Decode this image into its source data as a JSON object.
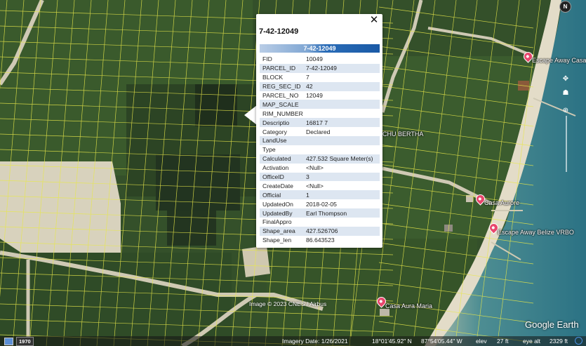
{
  "popup": {
    "title": "7-42-12049",
    "close_glyph": "✕",
    "header": "7-42-12049",
    "attributes": [
      {
        "key": "FID",
        "value": "10049"
      },
      {
        "key": "PARCEL_ID",
        "value": "7-42-12049"
      },
      {
        "key": "BLOCK",
        "value": "7"
      },
      {
        "key": "REG_SEC_ID",
        "value": "42"
      },
      {
        "key": "PARCEL_NO",
        "value": "12049"
      },
      {
        "key": "MAP_SCALE",
        "value": ""
      },
      {
        "key": "RIM_NUMBER",
        "value": ""
      },
      {
        "key": "Descriptio",
        "value": "16817 7"
      },
      {
        "key": "Category",
        "value": "Declared"
      },
      {
        "key": "LandUse",
        "value": ""
      },
      {
        "key": "Type",
        "value": ""
      },
      {
        "key": "Calculated",
        "value": "427.532 Square Meter(s)"
      },
      {
        "key": "Activation",
        "value": "<Null>"
      },
      {
        "key": "OfficeID",
        "value": "3"
      },
      {
        "key": "CreateDate",
        "value": "<Null>"
      },
      {
        "key": "Official",
        "value": "1"
      },
      {
        "key": "UpdatedOn",
        "value": "2018-02-05"
      },
      {
        "key": "UpdatedBy",
        "value": "Earl Thompson"
      },
      {
        "key": "FinalAppro",
        "value": ""
      },
      {
        "key": "Shape_area",
        "value": "427.526706"
      },
      {
        "key": "Shape_len",
        "value": "86.643523"
      }
    ]
  },
  "places": {
    "escape_away_casa": "Escape Away Casa",
    "chu_bertha": "CHU BERTHA",
    "casa_aurore": "Casa Aurore",
    "escape_away_vrbo": "Escape Away Belize VRBO",
    "casa_aura_maria": "Casa Aura Maria"
  },
  "map": {
    "copyright": "Image © 2023 CNES / Airbus",
    "logo": "Google Earth",
    "north": "N"
  },
  "status": {
    "historical_year": "1970",
    "imagery_date": "Imagery Date: 1/26/2021",
    "lat": "18°01'45.92\" N",
    "lon": "87°54'05.44\" W",
    "elev_label": "elev",
    "elev": "27 ft",
    "eye_label": "eye alt",
    "eye": "2329 ft"
  },
  "colors": {
    "parcel_lines": "#e8e84a",
    "pin": "#e8476d",
    "sea": "#2e7f8f",
    "vegetation": "#3d5a2e"
  }
}
